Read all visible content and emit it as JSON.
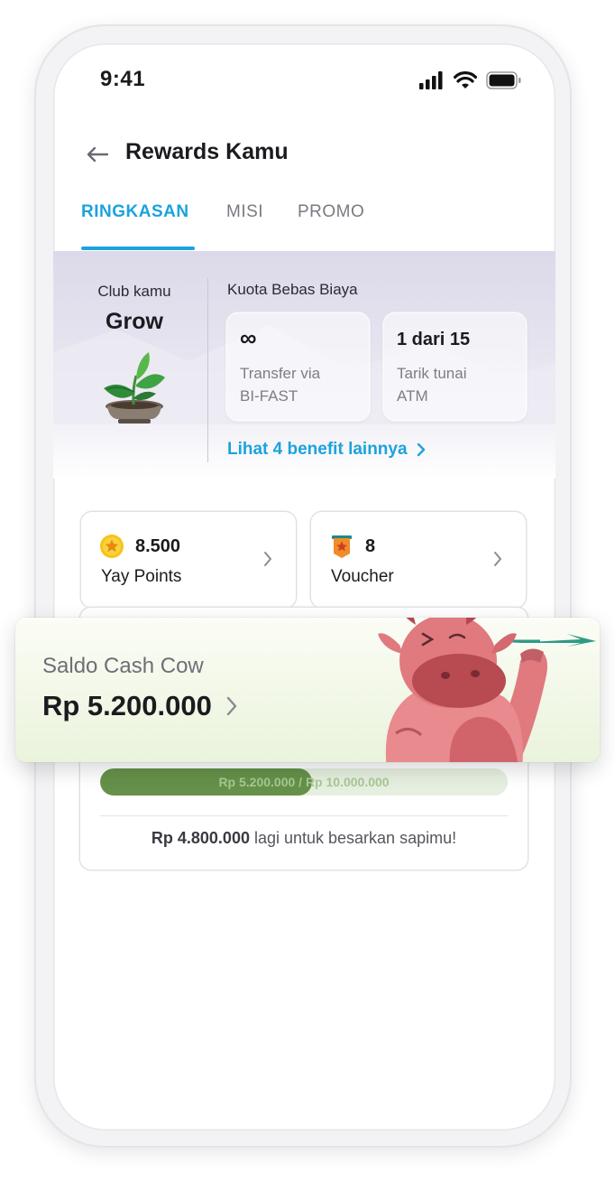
{
  "status_bar": {
    "time": "9:41"
  },
  "header": {
    "title": "Rewards Kamu"
  },
  "tabs": [
    {
      "label": "RINGKASAN",
      "active": true
    },
    {
      "label": "MISI",
      "active": false
    },
    {
      "label": "PROMO",
      "active": false
    }
  ],
  "club": {
    "label": "Club kamu",
    "name": "Grow"
  },
  "kuota": {
    "title": "Kuota Bebas Biaya",
    "cards": [
      {
        "value": "∞",
        "desc_line1": "Transfer via",
        "desc_line2": "BI-FAST"
      },
      {
        "value": "1 dari 15",
        "desc_line1": "Tarik tunai",
        "desc_line2": "ATM"
      }
    ],
    "more_link": "Lihat 4 benefit lainnya"
  },
  "points": {
    "value": "8.500",
    "label": "Yay Points"
  },
  "voucher": {
    "value": "8",
    "label": "Voucher"
  },
  "cash_cow": {
    "label": "Saldo Cash Cow",
    "amount": "Rp 5.200.000"
  },
  "progress": {
    "text": "Rp 5.200.000 / Rp 10.000.000",
    "fraction": 0.52,
    "remaining_amount": "Rp 4.800.000",
    "remaining_text": " lagi untuk besarkan sapimu!"
  },
  "colors": {
    "accent": "#1ba3dc",
    "progress_fill": "#66914a",
    "cow": "#e07a7f"
  }
}
